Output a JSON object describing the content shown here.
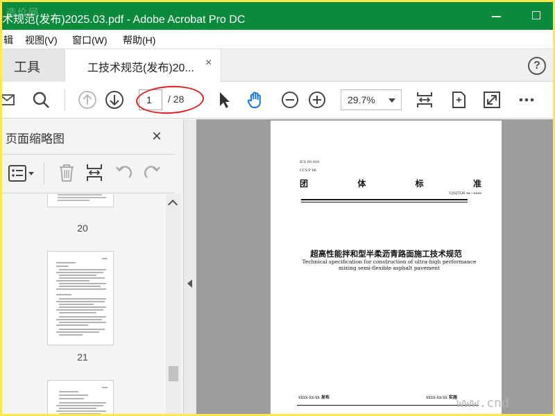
{
  "window": {
    "title": "术规范(发布)2025.03.pdf - Adobe Acrobat Pro DC",
    "watermark": "造价网"
  },
  "menu": [
    "辑",
    "视图(V)",
    "窗口(W)",
    "帮助(H)"
  ],
  "tabs": {
    "tools_label": "工具",
    "document_label": "工技术规范(发布)20...",
    "close_symbol": "×",
    "help_symbol": "?"
  },
  "toolbar": {
    "current_page": "1",
    "total_pages": "/ 28",
    "zoom": "29.7%"
  },
  "thumbnail_panel": {
    "title": "页面缩略图",
    "close_symbol": "×",
    "page_numbers": [
      "20",
      "21"
    ]
  },
  "document": {
    "code_line1": "ICS 93 010",
    "code_line2": "CCS P 66",
    "standard_type_chars": [
      "团",
      "体",
      "标",
      "准"
    ],
    "standard_code": "T/JSJTQX xx—xxxx",
    "title_cn": "超高性能拌和型半柔沥青路面施工技术规范",
    "title_en": "Technical specification for construction of ultra-high performance mixing semi-flexible asphalt pavement",
    "publish_date": "xxxx-xx-xx",
    "publish_label": "发布",
    "implement_date": "xxxx-xx-xx",
    "implement_label": "实施",
    "watermark": "www.cnd"
  },
  "colors": {
    "titlebar": "#0a8a3a",
    "border": "#ffe94a",
    "annotation_ring": "#e02020",
    "document_bg": "#9d9d9d"
  }
}
